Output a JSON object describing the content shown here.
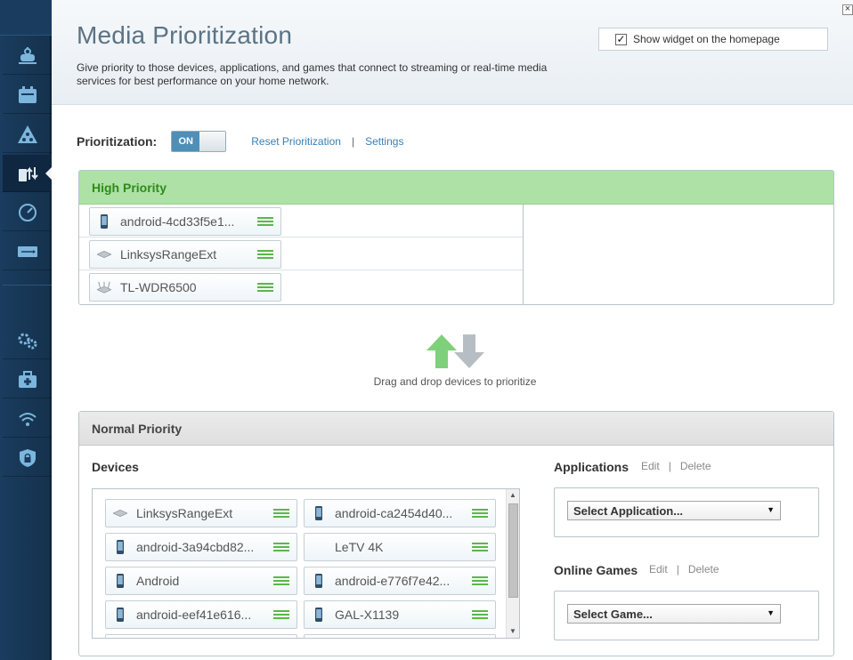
{
  "header": {
    "title": "Media Prioritization",
    "description": "Give priority to those devices, applications, and games that connect to streaming or real-time media services for best performance on your home network.",
    "widget_label": "Show widget on the homepage",
    "widget_checked": "✓",
    "close": "×"
  },
  "controls": {
    "prioritization_label": "Prioritization:",
    "toggle_state": "ON",
    "reset_link": "Reset Prioritization",
    "separator": "|",
    "settings_link": "Settings"
  },
  "high_priority": {
    "title": "High Priority",
    "devices": [
      {
        "name": "android-4cd33f5e1...",
        "icon": "phone-icon"
      },
      {
        "name": "LinksysRangeExt",
        "icon": "range-extender-icon"
      },
      {
        "name": "TL-WDR6500",
        "icon": "router-icon"
      }
    ]
  },
  "drag_hint": "Drag and drop devices to prioritize",
  "normal_priority": {
    "title": "Normal Priority",
    "devices_label": "Devices",
    "devices": [
      {
        "name": "LinksysRangeExt",
        "icon": "range-extender-icon"
      },
      {
        "name": "android-ca2454d40...",
        "icon": "phone-icon"
      },
      {
        "name": "android-3a94cbd82...",
        "icon": "phone-icon"
      },
      {
        "name": "LeTV 4K",
        "icon": "none"
      },
      {
        "name": "Android",
        "icon": "phone-icon"
      },
      {
        "name": "android-e776f7e42...",
        "icon": "phone-icon"
      },
      {
        "name": "android-eef41e616...",
        "icon": "phone-icon"
      },
      {
        "name": "GAL-X1139",
        "icon": "phone-icon"
      }
    ],
    "applications": {
      "label": "Applications",
      "edit": "Edit",
      "delete": "Delete",
      "select_value": "Select Application..."
    },
    "games": {
      "label": "Online Games",
      "edit": "Edit",
      "delete": "Delete",
      "select_value": "Select Game..."
    }
  },
  "sidebar": {
    "items": [
      {
        "icon": "router-settings-icon"
      },
      {
        "icon": "calendar-icon"
      },
      {
        "icon": "network-map-icon"
      },
      {
        "icon": "media-prioritization-icon"
      },
      {
        "icon": "speed-test-icon"
      },
      {
        "icon": "usb-storage-icon"
      },
      {
        "icon": "connectivity-gear-icon"
      },
      {
        "icon": "troubleshooting-icon"
      },
      {
        "icon": "wireless-icon"
      },
      {
        "icon": "security-icon"
      }
    ]
  },
  "colors": {
    "accent": "#4e8fb8",
    "high_priority_bg": "#ade1a5",
    "high_priority_text": "#2f8b1c",
    "link": "#3a7fb5",
    "grip": "#5ab84a"
  }
}
